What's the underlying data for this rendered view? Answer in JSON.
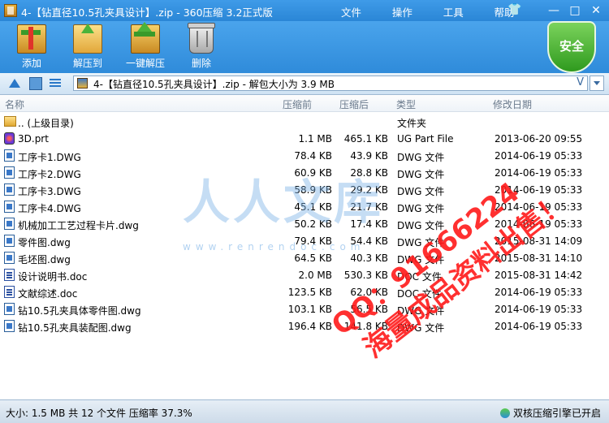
{
  "window": {
    "title": "4-【钻直径10.5孔夹具设计】.zip - 360压缩 3.2正式版",
    "menu": [
      "文件",
      "操作",
      "工具",
      "帮助"
    ],
    "controls": {
      "minimize": "—",
      "maximize": "□",
      "close": "✕"
    }
  },
  "toolbar": {
    "add": "添加",
    "extract_to": "解压到",
    "one_click_extract": "一键解压",
    "delete": "删除",
    "security_badge": "安全"
  },
  "address": {
    "path": "4-【钻直径10.5孔夹具设计】.zip - 解包大小为 3.9 MB",
    "v": "V"
  },
  "columns": {
    "name": "名称",
    "packed": "压缩前",
    "size": "压缩后",
    "type": "类型",
    "modified": "修改日期"
  },
  "files": [
    {
      "name": ".. (上级目录)",
      "packed": "",
      "size": "",
      "type": "文件夹",
      "modified": "",
      "icon": "folder"
    },
    {
      "name": "3D.prt",
      "packed": "1.1 MB",
      "size": "465.1 KB",
      "type": "UG Part File",
      "modified": "2013-06-20 09:55",
      "icon": "prt"
    },
    {
      "name": "工序卡1.DWG",
      "packed": "78.4 KB",
      "size": "43.9 KB",
      "type": "DWG 文件",
      "modified": "2014-06-19 05:33",
      "icon": "dwg"
    },
    {
      "name": "工序卡2.DWG",
      "packed": "60.9 KB",
      "size": "28.8 KB",
      "type": "DWG 文件",
      "modified": "2014-06-19 05:33",
      "icon": "dwg"
    },
    {
      "name": "工序卡3.DWG",
      "packed": "58.9 KB",
      "size": "29.2 KB",
      "type": "DWG 文件",
      "modified": "2014-06-19 05:33",
      "icon": "dwg"
    },
    {
      "name": "工序卡4.DWG",
      "packed": "45.1 KB",
      "size": "21.7 KB",
      "type": "DWG 文件",
      "modified": "2014-06-19 05:33",
      "icon": "dwg"
    },
    {
      "name": "机械加工工艺过程卡片.dwg",
      "packed": "50.2 KB",
      "size": "17.4 KB",
      "type": "DWG 文件",
      "modified": "2014-06-19 05:33",
      "icon": "dwg"
    },
    {
      "name": "零件图.dwg",
      "packed": "79.4 KB",
      "size": "54.4 KB",
      "type": "DWG 文件",
      "modified": "2015-08-31 14:09",
      "icon": "dwg"
    },
    {
      "name": "毛坯图.dwg",
      "packed": "64.5 KB",
      "size": "40.3 KB",
      "type": "DWG 文件",
      "modified": "2015-08-31 14:10",
      "icon": "dwg"
    },
    {
      "name": "设计说明书.doc",
      "packed": "2.0 MB",
      "size": "530.3 KB",
      "type": "DOC 文件",
      "modified": "2015-08-31 14:42",
      "icon": "doc"
    },
    {
      "name": "文献综述.doc",
      "packed": "123.5 KB",
      "size": "62.0 KB",
      "type": "DOC 文件",
      "modified": "2014-06-19 05:33",
      "icon": "doc"
    },
    {
      "name": "钻10.5孔夹具体零件图.dwg",
      "packed": "103.1 KB",
      "size": "56.5 KB",
      "type": "DWG 文件",
      "modified": "2014-06-19 05:33",
      "icon": "dwg"
    },
    {
      "name": "钻10.5孔夹具装配图.dwg",
      "packed": "196.4 KB",
      "size": "141.8 KB",
      "type": "DWG 文件",
      "modified": "2014-06-19 05:33",
      "icon": "dwg"
    }
  ],
  "watermarks": {
    "logo": "人人文库",
    "url": "www.renrendoc.com",
    "qq": "QQ：91666224",
    "slogan": "海量成品资料出售！"
  },
  "status": {
    "summary": "大小: 1.5 MB 共 12 个文件 压缩率 37.3%",
    "engine": "双核压缩引擎已开启"
  },
  "colors": {
    "chrome_blue": "#2a86d6",
    "security_green": "#2f9a1e",
    "watermark_red": "#ff1a1a"
  }
}
